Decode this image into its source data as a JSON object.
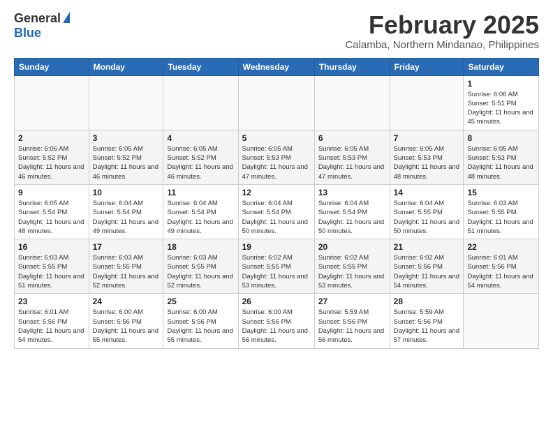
{
  "header": {
    "logo_general": "General",
    "logo_blue": "Blue",
    "month_title": "February 2025",
    "location": "Calamba, Northern Mindanao, Philippines"
  },
  "days_of_week": [
    "Sunday",
    "Monday",
    "Tuesday",
    "Wednesday",
    "Thursday",
    "Friday",
    "Saturday"
  ],
  "weeks": [
    [
      {
        "day": "",
        "info": ""
      },
      {
        "day": "",
        "info": ""
      },
      {
        "day": "",
        "info": ""
      },
      {
        "day": "",
        "info": ""
      },
      {
        "day": "",
        "info": ""
      },
      {
        "day": "",
        "info": ""
      },
      {
        "day": "1",
        "info": "Sunrise: 6:06 AM\nSunset: 5:51 PM\nDaylight: 11 hours and 45 minutes."
      }
    ],
    [
      {
        "day": "2",
        "info": "Sunrise: 6:06 AM\nSunset: 5:52 PM\nDaylight: 11 hours and 46 minutes."
      },
      {
        "day": "3",
        "info": "Sunrise: 6:05 AM\nSunset: 5:52 PM\nDaylight: 11 hours and 46 minutes."
      },
      {
        "day": "4",
        "info": "Sunrise: 6:05 AM\nSunset: 5:52 PM\nDaylight: 11 hours and 46 minutes."
      },
      {
        "day": "5",
        "info": "Sunrise: 6:05 AM\nSunset: 5:53 PM\nDaylight: 11 hours and 47 minutes."
      },
      {
        "day": "6",
        "info": "Sunrise: 6:05 AM\nSunset: 5:53 PM\nDaylight: 11 hours and 47 minutes."
      },
      {
        "day": "7",
        "info": "Sunrise: 6:05 AM\nSunset: 5:53 PM\nDaylight: 11 hours and 48 minutes."
      },
      {
        "day": "8",
        "info": "Sunrise: 6:05 AM\nSunset: 5:53 PM\nDaylight: 11 hours and 48 minutes."
      }
    ],
    [
      {
        "day": "9",
        "info": "Sunrise: 6:05 AM\nSunset: 5:54 PM\nDaylight: 11 hours and 48 minutes."
      },
      {
        "day": "10",
        "info": "Sunrise: 6:04 AM\nSunset: 5:54 PM\nDaylight: 11 hours and 49 minutes."
      },
      {
        "day": "11",
        "info": "Sunrise: 6:04 AM\nSunset: 5:54 PM\nDaylight: 11 hours and 49 minutes."
      },
      {
        "day": "12",
        "info": "Sunrise: 6:04 AM\nSunset: 5:54 PM\nDaylight: 11 hours and 50 minutes."
      },
      {
        "day": "13",
        "info": "Sunrise: 6:04 AM\nSunset: 5:54 PM\nDaylight: 11 hours and 50 minutes."
      },
      {
        "day": "14",
        "info": "Sunrise: 6:04 AM\nSunset: 5:55 PM\nDaylight: 11 hours and 50 minutes."
      },
      {
        "day": "15",
        "info": "Sunrise: 6:03 AM\nSunset: 5:55 PM\nDaylight: 11 hours and 51 minutes."
      }
    ],
    [
      {
        "day": "16",
        "info": "Sunrise: 6:03 AM\nSunset: 5:55 PM\nDaylight: 11 hours and 51 minutes."
      },
      {
        "day": "17",
        "info": "Sunrise: 6:03 AM\nSunset: 5:55 PM\nDaylight: 11 hours and 52 minutes."
      },
      {
        "day": "18",
        "info": "Sunrise: 6:03 AM\nSunset: 5:55 PM\nDaylight: 11 hours and 52 minutes."
      },
      {
        "day": "19",
        "info": "Sunrise: 6:02 AM\nSunset: 5:55 PM\nDaylight: 11 hours and 53 minutes."
      },
      {
        "day": "20",
        "info": "Sunrise: 6:02 AM\nSunset: 5:55 PM\nDaylight: 11 hours and 53 minutes."
      },
      {
        "day": "21",
        "info": "Sunrise: 6:02 AM\nSunset: 5:56 PM\nDaylight: 11 hours and 54 minutes."
      },
      {
        "day": "22",
        "info": "Sunrise: 6:01 AM\nSunset: 5:56 PM\nDaylight: 11 hours and 54 minutes."
      }
    ],
    [
      {
        "day": "23",
        "info": "Sunrise: 6:01 AM\nSunset: 5:56 PM\nDaylight: 11 hours and 54 minutes."
      },
      {
        "day": "24",
        "info": "Sunrise: 6:00 AM\nSunset: 5:56 PM\nDaylight: 11 hours and 55 minutes."
      },
      {
        "day": "25",
        "info": "Sunrise: 6:00 AM\nSunset: 5:56 PM\nDaylight: 11 hours and 55 minutes."
      },
      {
        "day": "26",
        "info": "Sunrise: 6:00 AM\nSunset: 5:56 PM\nDaylight: 11 hours and 56 minutes."
      },
      {
        "day": "27",
        "info": "Sunrise: 5:59 AM\nSunset: 5:56 PM\nDaylight: 11 hours and 56 minutes."
      },
      {
        "day": "28",
        "info": "Sunrise: 5:59 AM\nSunset: 5:56 PM\nDaylight: 11 hours and 57 minutes."
      },
      {
        "day": "",
        "info": ""
      }
    ]
  ]
}
